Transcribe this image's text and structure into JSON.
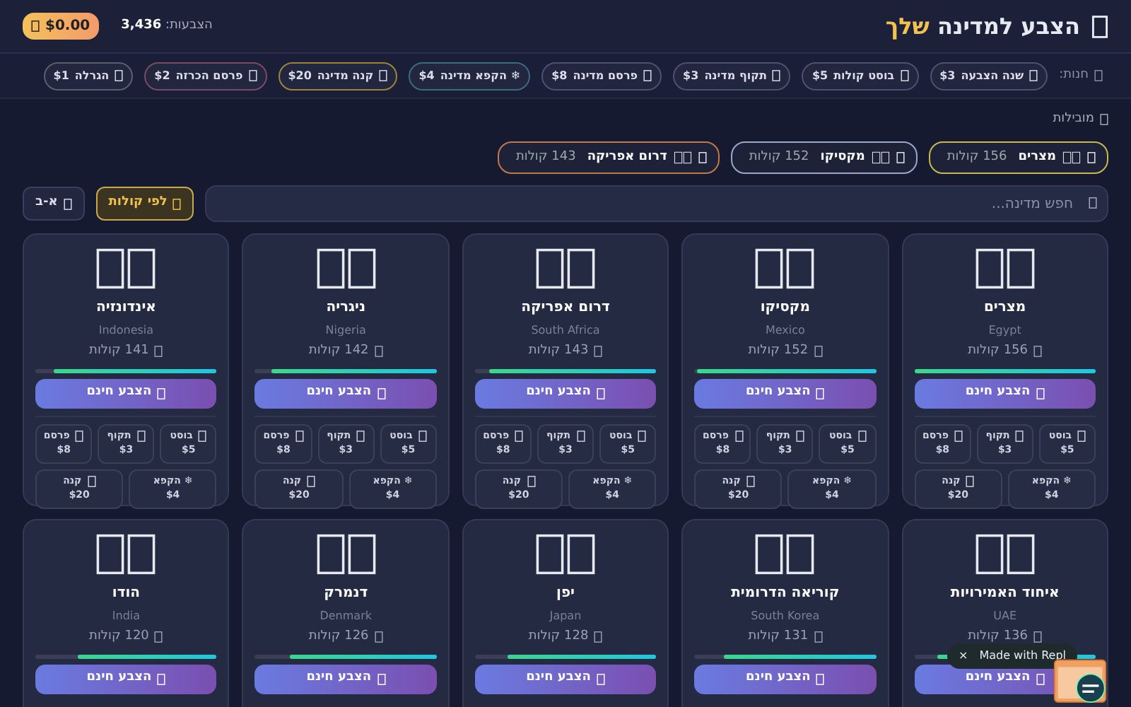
{
  "header": {
    "title": "הצבע למדינה",
    "title_highlight": "שלך",
    "votes": "הצבעות: **3,436**",
    "balance": "$0.00"
  },
  "shop": {
    "label": "חנות:",
    "items": [
      {
        "label": "שנה הצבעה",
        "price": "$3",
        "color": "#4a5270"
      },
      {
        "label": "בוסט קולות",
        "price": "$5",
        "color": "#4a5270"
      },
      {
        "label": "תקוף מדינה",
        "price": "$3",
        "color": "#4a5270"
      },
      {
        "label": "פרסם מדינה",
        "price": "$8",
        "color": "#4a5270"
      },
      {
        "label": "הקפא מדינה",
        "price": "$4",
        "symbol": "❄",
        "color": "#3c6a80"
      },
      {
        "label": "קנה מדינה",
        "price": "$20",
        "color": "#9a8440"
      },
      {
        "label": "פרסם הכרזה",
        "price": "$2",
        "color": "#7a4a6a"
      },
      {
        "label": "הגרלה",
        "price": "$1",
        "color": "#5a5f70"
      }
    ]
  },
  "leaders": {
    "title": "מובילות",
    "items": [
      {
        "name": "מצרים",
        "votes": "156",
        "unit": "קולות",
        "color": "#c8b850"
      },
      {
        "name": "מקסיקו",
        "votes": "152",
        "unit": "קולות",
        "color": "#9aa8c8"
      },
      {
        "name": "דרום אפריקה",
        "votes": "143",
        "unit": "קולות",
        "color": "#c07848"
      }
    ]
  },
  "search": {
    "placeholder": "חפש מדינה..."
  },
  "sort": [
    {
      "label": "לפי קולות",
      "selected": true
    },
    {
      "label": "א-ב",
      "selected": false
    }
  ],
  "cards": [
    {
      "name": "מצרים",
      "english": "Egypt",
      "votes": "156 קולות",
      "level": 1.0,
      "button": "הצבע חינם",
      "actions": [
        {
          "label": "בוסט",
          "price": "$5"
        },
        {
          "label": "תקוף",
          "price": "$3"
        },
        {
          "label": "פרסם",
          "price": "$8"
        },
        {
          "label": "הקפא",
          "price": "$4",
          "symbol": "❄"
        },
        {
          "label": "קנה",
          "price": "$20"
        }
      ]
    },
    {
      "name": "מקסיקו",
      "english": "Mexico",
      "votes": "152 קולות",
      "level": 0.99,
      "button": "הצבע חינם",
      "actions": [
        {
          "label": "בוסט",
          "price": "$5"
        },
        {
          "label": "תקוף",
          "price": "$3"
        },
        {
          "label": "פרסם",
          "price": "$8"
        },
        {
          "label": "הקפא",
          "price": "$4",
          "symbol": "❄"
        },
        {
          "label": "קנה",
          "price": "$20"
        }
      ]
    },
    {
      "name": "דרום אפריקה",
      "english": "South Africa",
      "votes": "143 קולות",
      "level": 0.92,
      "button": "הצבע חינם",
      "actions": [
        {
          "label": "בוסט",
          "price": "$5"
        },
        {
          "label": "תקוף",
          "price": "$3"
        },
        {
          "label": "פרסם",
          "price": "$8"
        },
        {
          "label": "הקפא",
          "price": "$4",
          "symbol": "❄"
        },
        {
          "label": "קנה",
          "price": "$20"
        }
      ]
    },
    {
      "name": "ניגריה",
      "english": "Nigeria",
      "votes": "142 קולות",
      "level": 0.91,
      "button": "הצבע חינם",
      "actions": [
        {
          "label": "בוסט",
          "price": "$5"
        },
        {
          "label": "תקוף",
          "price": "$3"
        },
        {
          "label": "פרסם",
          "price": "$8"
        },
        {
          "label": "הקפא",
          "price": "$4",
          "symbol": "❄"
        },
        {
          "label": "קנה",
          "price": "$20"
        }
      ]
    },
    {
      "name": "אינדונזיה",
      "english": "Indonesia",
      "votes": "141 קולות",
      "level": 0.9,
      "button": "הצבע חינם",
      "actions": [
        {
          "label": "בוסט",
          "price": "$5"
        },
        {
          "label": "תקוף",
          "price": "$3"
        },
        {
          "label": "פרסם",
          "price": "$8"
        },
        {
          "label": "הקפא",
          "price": "$4",
          "symbol": "❄"
        },
        {
          "label": "קנה",
          "price": "$20"
        }
      ]
    },
    {
      "name": "איחוד האמירויות",
      "english": "UAE",
      "votes": "136 קולות",
      "level": 0.87,
      "button": "הצבע חינם"
    },
    {
      "name": "קוריאה הדרומית",
      "english": "South Korea",
      "votes": "131 קולות",
      "level": 0.84,
      "button": "הצבע חינם"
    },
    {
      "name": "יפן",
      "english": "Japan",
      "votes": "128 קולות",
      "level": 0.82,
      "button": "הצבע חינם"
    },
    {
      "name": "דנמרק",
      "english": "Denmark",
      "votes": "126 קולות",
      "level": 0.81,
      "button": "הצבע חינם"
    },
    {
      "name": "הודו",
      "english": "India",
      "votes": "120 קולות",
      "level": 0.77,
      "button": "הצבע חינם"
    }
  ],
  "badge": {
    "text": "Made with Repl",
    "close": "×"
  }
}
